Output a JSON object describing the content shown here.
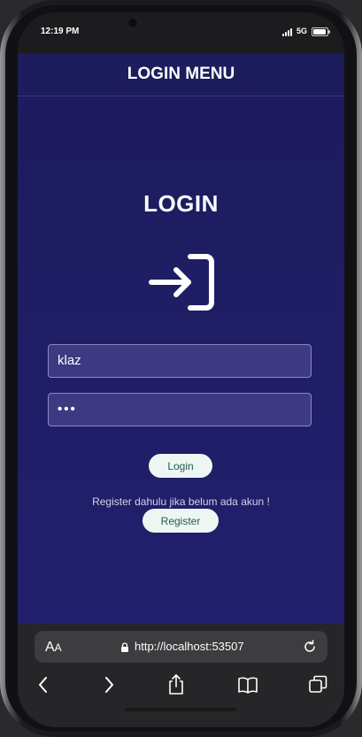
{
  "status_bar": {
    "time": "12:19 PM",
    "network": "5G",
    "battery_level": 0.9
  },
  "app_bar": {
    "title": "LOGIN MENU"
  },
  "login": {
    "heading": "LOGIN",
    "icon": "login-arrow-icon",
    "username_value": "klaz",
    "password_masked": "•••",
    "login_button": "Login",
    "register_hint": "Register dahulu jika belum ada akun !",
    "register_button": "Register"
  },
  "browser": {
    "text_size_label_big": "A",
    "text_size_label_small": "A",
    "url": "http://localhost:53507",
    "toolbar_icons": [
      "back-icon",
      "forward-icon",
      "share-icon",
      "bookmarks-icon",
      "tabs-icon"
    ]
  },
  "colors": {
    "app_background": "#1d1c5c",
    "field_background": "#3d3a82",
    "button_background": "#eef6f3",
    "button_text": "#1d5d4a"
  }
}
